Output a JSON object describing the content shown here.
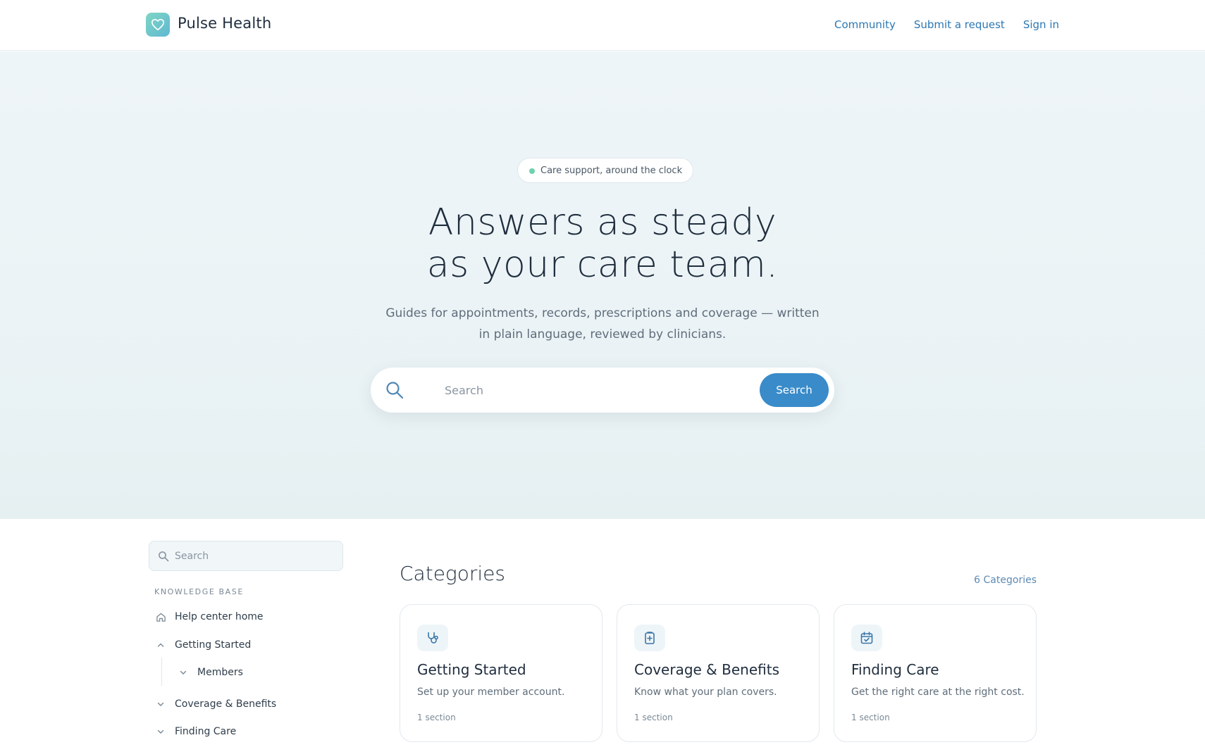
{
  "brand": {
    "name": "Pulse Health",
    "icon": "heart-icon",
    "accent": "#6cc9c8"
  },
  "nav": {
    "community": "Community",
    "submit_request": "Submit a request",
    "sign_in": "Sign in"
  },
  "hero": {
    "badge": "Care support, around the clock",
    "title_line1": "Answers as steady",
    "title_line2": "as your care team.",
    "subtitle": "Guides for appointments, records, prescriptions and coverage — written in plain language, reviewed by clinicians.",
    "search_placeholder": "Search",
    "search_button": "Search"
  },
  "sidebar": {
    "search_placeholder": "Search",
    "section_label": "KNOWLEDGE BASE",
    "items": [
      {
        "label": "Help center home",
        "icon": "home-icon"
      },
      {
        "label": "Getting Started",
        "icon": "chevron-up-icon"
      },
      {
        "label": "Members",
        "icon": "chevron-down-icon"
      },
      {
        "label": "Coverage & Benefits",
        "icon": "chevron-down-icon"
      },
      {
        "label": "Finding Care",
        "icon": "chevron-down-icon"
      }
    ]
  },
  "categories": {
    "title": "Categories",
    "count": "6 Categories",
    "cards": [
      {
        "title": "Getting Started",
        "description": "Set up your member account.",
        "sections": "1 section",
        "icon": "stethoscope-icon"
      },
      {
        "title": "Coverage & Benefits",
        "description": "Know what your plan covers.",
        "sections": "1 section",
        "icon": "medical-document-icon"
      },
      {
        "title": "Finding Care",
        "description": "Get the right care at the right cost.",
        "sections": "1 section",
        "icon": "calendar-check-icon"
      }
    ]
  },
  "colors": {
    "primary_button": "#3a8bc9",
    "link": "#2d78b3",
    "status_dot": "#6fd1ad"
  }
}
